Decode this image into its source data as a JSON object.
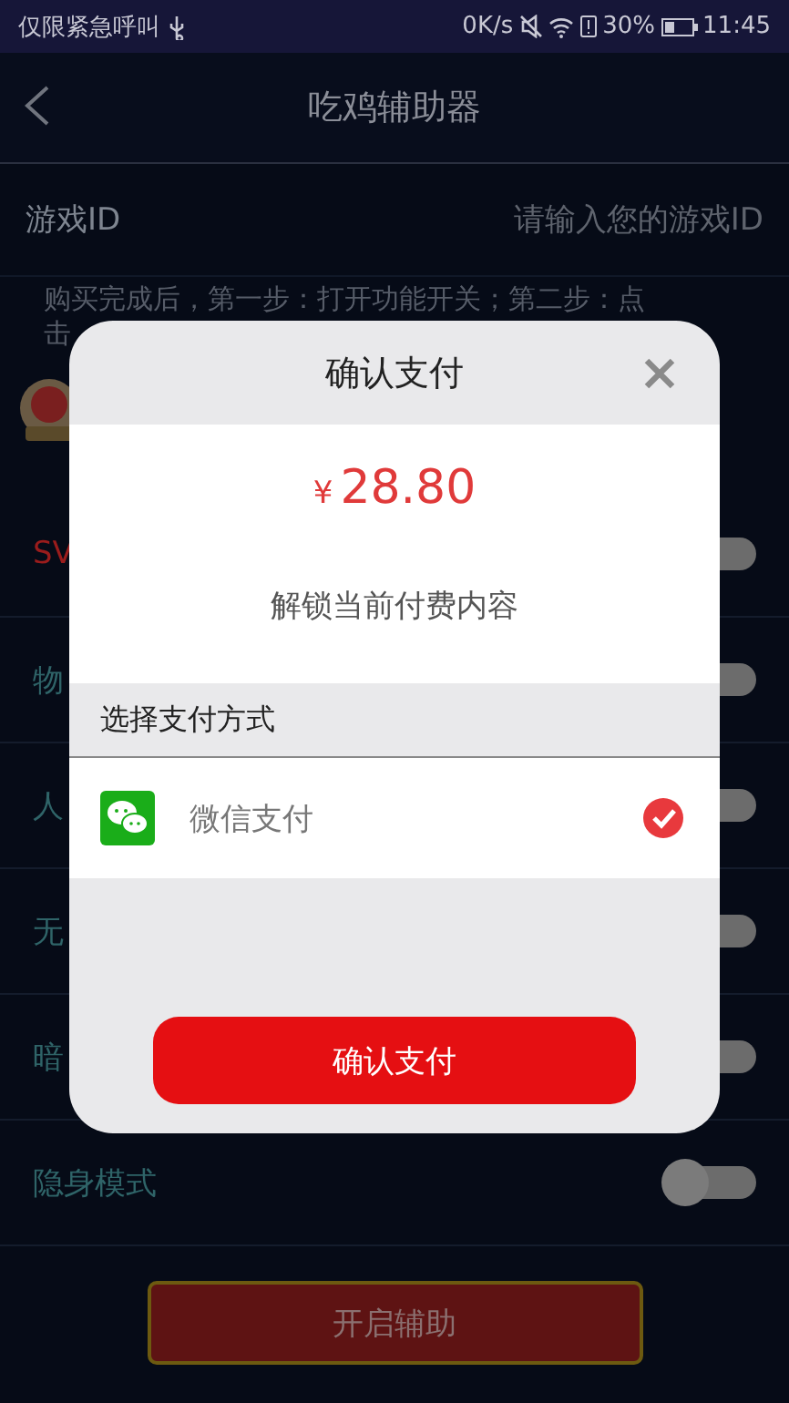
{
  "status_bar": {
    "carrier": "仅限紧急呼叫",
    "speed": "0K/s",
    "battery": "30%",
    "time": "11:45"
  },
  "header": {
    "title": "吃鸡辅助器"
  },
  "game_id": {
    "label": "游戏ID",
    "placeholder": "请输入您的游戏ID"
  },
  "notice": {
    "lines": [
      "购买完成后，第一步：打开功能开关；第二步：点",
      "击"
    ]
  },
  "features": [
    {
      "label": "SV",
      "color": "#9a1c1c",
      "on": false
    },
    {
      "label": "物",
      "color": "#2f6468",
      "on": false
    },
    {
      "label": "人",
      "color": "#2f6468",
      "on": false
    },
    {
      "label": "无",
      "color": "#2f6468",
      "on": false
    },
    {
      "label": "暗",
      "color": "#2f6468",
      "on": false
    },
    {
      "label": "隐身模式",
      "color": "#2f6468",
      "on": false
    }
  ],
  "start_button": {
    "label": "开启辅助"
  },
  "dialog": {
    "title": "确认支付",
    "currency": "¥",
    "amount": "28.80",
    "description": "解锁当前付费内容",
    "section_title": "选择支付方式",
    "methods": [
      {
        "name": "微信支付",
        "selected": true
      }
    ],
    "confirm_button": "确认支付"
  }
}
